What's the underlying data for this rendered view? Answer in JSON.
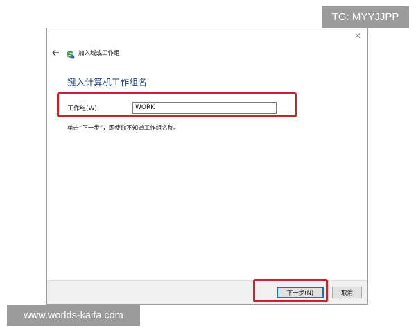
{
  "dialog": {
    "header_title": "加入域或工作组",
    "page_title": "键入计算机工作组名",
    "workgroup_label": "工作组(W):",
    "workgroup_value": "WORK",
    "hint": "单击“下一步”，即使你不知道工作组名称。",
    "close_glyph": "✕"
  },
  "footer": {
    "next_label": "下一步(N)",
    "cancel_label": "取消"
  },
  "watermarks": {
    "tg": "TG: MYYJJPP",
    "site": "www.worlds-kaifa.com"
  },
  "icons": {
    "back": "back-arrow-icon",
    "network": "network-globe-icon",
    "close": "close-icon"
  },
  "colors": {
    "highlight": "#c1262c",
    "title": "#1f3f7a",
    "accent": "#0078d7",
    "footer_bg": "#f0f0f0"
  }
}
